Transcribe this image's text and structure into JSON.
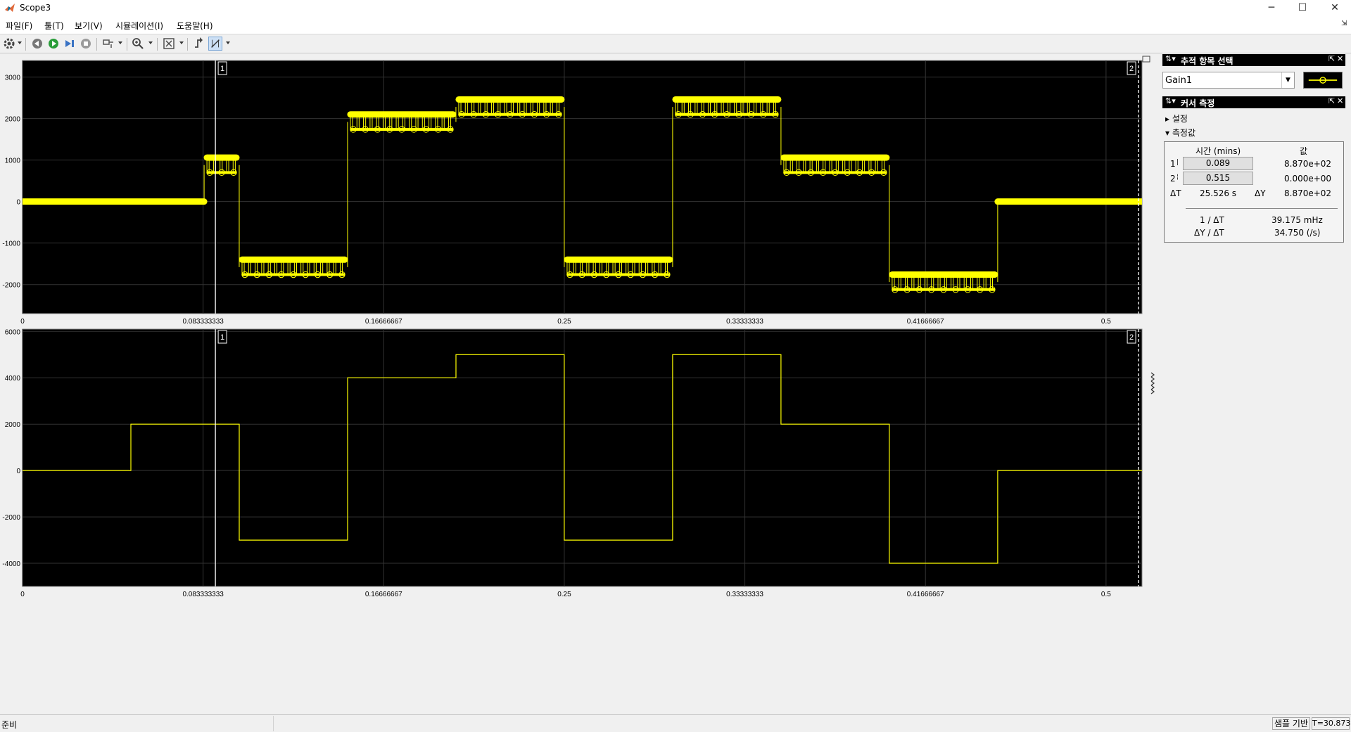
{
  "window": {
    "title": "Scope3",
    "minimize_glyph": "─",
    "maximize_glyph": "☐",
    "close_glyph": "✕"
  },
  "menu": [
    "파일(F)",
    "툴(T)",
    "보기(V)",
    "시뮬레이션(I)",
    "도움말(H)"
  ],
  "toolbar": {
    "icons": [
      "settings-icon",
      "step-back-icon",
      "run-icon",
      "step-forward-icon",
      "stop-icon",
      "highlight-block-icon",
      "zoom-in-icon",
      "fit-to-view-icon",
      "trigger-icon",
      "cursor-measurement-icon"
    ]
  },
  "colors": {
    "plot_bg": "#000000",
    "grid": "#333333",
    "trace": "#ffff00",
    "cursor": "#ffffff",
    "axis_text": "#000000"
  },
  "chart_data": [
    {
      "type": "line",
      "title": "",
      "marker": "circle",
      "xlim": [
        0,
        0.5166
      ],
      "ylim": [
        -2700,
        3400
      ],
      "x_ticks": [
        0,
        0.083333333,
        0.16666667,
        0.25,
        0.33333333,
        0.41666667,
        0.5
      ],
      "x_tick_labels": [
        "0",
        "0.083333333",
        "0.16666667",
        "0.25",
        "0.33333333",
        "0.41666667",
        "0.5"
      ],
      "y_ticks": [
        -2000,
        -1000,
        0,
        1000,
        2000,
        3000
      ],
      "y_tick_labels": [
        "-2000",
        "-1000",
        "0",
        "1000",
        "2000",
        "3000"
      ],
      "grid": true,
      "series": [
        {
          "segments": [
            {
              "x": [
                0,
                0.0838
              ],
              "y_low": 0,
              "y_high": 0
            },
            {
              "x": [
                0.0838,
                0.1
              ],
              "y_low": 700,
              "y_high": 1060
            },
            {
              "x": [
                0.1,
                0.15
              ],
              "y_low": -1760,
              "y_high": -1400
            },
            {
              "x": [
                0.15,
                0.2
              ],
              "y_low": 1740,
              "y_high": 2100
            },
            {
              "x": [
                0.2,
                0.25
              ],
              "y_low": 2100,
              "y_high": 2460
            },
            {
              "x": [
                0.25,
                0.3
              ],
              "y_low": -1760,
              "y_high": -1400
            },
            {
              "x": [
                0.3,
                0.35
              ],
              "y_low": 2100,
              "y_high": 2460
            },
            {
              "x": [
                0.35,
                0.4
              ],
              "y_low": 700,
              "y_high": 1060
            },
            {
              "x": [
                0.4,
                0.45
              ],
              "y_low": -2120,
              "y_high": -1760
            },
            {
              "x": [
                0.45,
                0.5166
              ],
              "y_low": 0,
              "y_high": 0
            }
          ]
        }
      ],
      "cursors": [
        {
          "label": "1",
          "x": 0.089
        },
        {
          "label": "2",
          "x": 0.515
        }
      ]
    },
    {
      "type": "line",
      "title": "",
      "xlim": [
        0,
        0.5166
      ],
      "ylim": [
        -5000,
        6100
      ],
      "x_ticks": [
        0,
        0.083333333,
        0.16666667,
        0.25,
        0.33333333,
        0.41666667,
        0.5
      ],
      "x_tick_labels": [
        "0",
        "0.083333333",
        "0.16666667",
        "0.25",
        "0.33333333",
        "0.41666667",
        "0.5"
      ],
      "y_ticks": [
        -4000,
        -2000,
        0,
        2000,
        4000,
        6000
      ],
      "y_tick_labels": [
        "-4000",
        "-2000",
        "0",
        "2000",
        "4000",
        "6000"
      ],
      "grid": true,
      "series": [
        {
          "x": [
            0,
            0.05,
            0.05,
            0.1,
            0.1,
            0.15,
            0.15,
            0.2,
            0.2,
            0.25,
            0.25,
            0.3,
            0.3,
            0.35,
            0.35,
            0.4,
            0.4,
            0.45,
            0.45,
            0.5166
          ],
          "y": [
            0,
            0,
            2000,
            2000,
            -3000,
            -3000,
            4000,
            4000,
            5000,
            5000,
            -3000,
            -3000,
            5000,
            5000,
            2000,
            2000,
            -4000,
            -4000,
            0,
            0
          ]
        }
      ],
      "cursors": [
        {
          "label": "1",
          "x": 0.089
        },
        {
          "label": "2",
          "x": 0.515
        }
      ]
    }
  ],
  "trace_panel": {
    "title": "추적 항목 선택",
    "selected_signal": "Gain1",
    "options": [
      "Gain1"
    ]
  },
  "cursor_panel": {
    "title": "커서 측정",
    "settings_label": "설정",
    "measurements_label": "측정값",
    "header_time": "시간 (mins)",
    "header_value": "값",
    "row1_label": "1",
    "row1_time": "0.089",
    "row1_value": "8.870e+02",
    "row2_label": "2",
    "row2_time": "0.515",
    "row2_value": "0.000e+00",
    "dt_label": "ΔT",
    "dt_value": "25.526 s",
    "dy_label": "ΔY",
    "dy_value": "8.870e+02",
    "inv_dt_label": "1 / ΔT",
    "inv_dt_value": "39.175 mHz",
    "dy_dt_label": "ΔY / ΔT",
    "dy_dt_value": "34.750 (/s)"
  },
  "status": {
    "text": "준비",
    "mode": "샘플 기반",
    "time": "T=30.873"
  }
}
